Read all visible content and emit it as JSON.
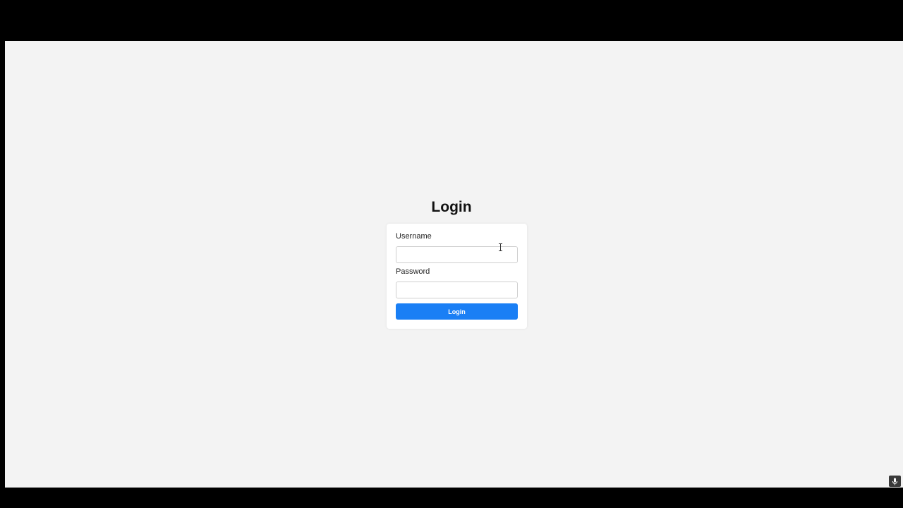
{
  "page": {
    "title": "Login",
    "background_color": "#f3f3f3",
    "frame_color": "#000000"
  },
  "login_form": {
    "username": {
      "label": "Username",
      "value": "",
      "placeholder": ""
    },
    "password": {
      "label": "Password",
      "value": "",
      "placeholder": ""
    },
    "submit_label": "Login",
    "accent_color": "#1a7ff5"
  },
  "icons": {
    "cursor": "text-cursor-icon",
    "mic": "microphone-icon"
  }
}
